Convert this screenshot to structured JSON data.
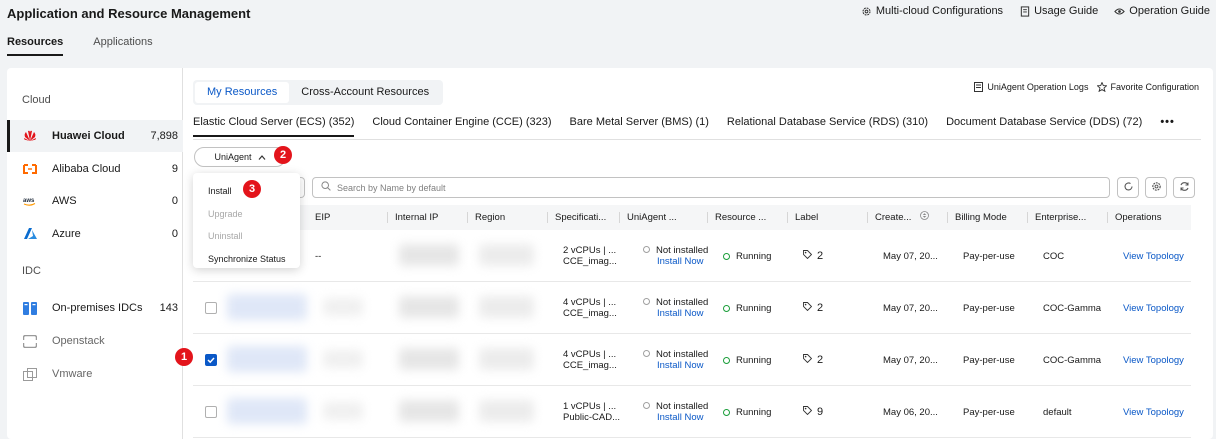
{
  "header": {
    "title": "Application and Resource Management",
    "links": [
      {
        "label": "Multi-cloud Configurations",
        "icon": "gear-icon"
      },
      {
        "label": "Usage Guide",
        "icon": "document-icon"
      },
      {
        "label": "Operation Guide",
        "icon": "eye-icon"
      }
    ],
    "tabs": [
      {
        "label": "Resources",
        "active": true
      },
      {
        "label": "Applications",
        "active": false
      }
    ]
  },
  "sidebar": {
    "groups": [
      {
        "label": "Cloud",
        "items": [
          {
            "label": "Huawei Cloud",
            "count": "7,898",
            "icon": "huawei-logo-icon",
            "active": true
          },
          {
            "label": "Alibaba Cloud",
            "count": "9",
            "icon": "alibaba-logo-icon"
          },
          {
            "label": "AWS",
            "count": "0",
            "icon": "aws-logo-icon"
          },
          {
            "label": "Azure",
            "count": "0",
            "icon": "azure-logo-icon"
          }
        ]
      },
      {
        "label": "IDC",
        "items": [
          {
            "label": "On-premises IDCs",
            "count": "143",
            "icon": "idc-icon"
          },
          {
            "label": "Openstack",
            "count": "",
            "icon": "openstack-icon"
          },
          {
            "label": "Vmware",
            "count": "",
            "icon": "vmware-icon"
          }
        ]
      }
    ]
  },
  "content": {
    "segments": [
      {
        "label": "My Resources",
        "active": true
      },
      {
        "label": "Cross-Account Resources",
        "active": false
      }
    ],
    "right_links": [
      {
        "label": "UniAgent Operation Logs",
        "icon": "log-icon"
      },
      {
        "label": "Favorite Configuration",
        "icon": "star-icon"
      }
    ],
    "service_tabs": [
      {
        "label": "Elastic Cloud Server (ECS) (352)",
        "active": true
      },
      {
        "label": "Cloud Container Engine (CCE) (323)"
      },
      {
        "label": "Bare Metal Server (BMS) (1)"
      },
      {
        "label": "Relational Database Service (RDS) (310)"
      },
      {
        "label": "Document Database Service (DDS) (72)"
      }
    ],
    "more_label": "•••",
    "uniagent_button": "UniAgent",
    "search_placeholder": "Search by Name by default",
    "dropdown": {
      "items": [
        {
          "label": "Install",
          "enabled": true
        },
        {
          "label": "Upgrade",
          "enabled": false
        },
        {
          "label": "Uninstall",
          "enabled": false
        },
        {
          "label": "Synchronize Status",
          "enabled": true
        }
      ]
    },
    "badges": [
      "1",
      "2",
      "3"
    ],
    "table": {
      "columns": [
        "EIP",
        "Internal IP",
        "Region",
        "Specificati...",
        "UniAgent ...",
        "Resource ...",
        "Label",
        "Create...",
        "Billing Mode",
        "Enterprise...",
        "Operations"
      ],
      "rows": [
        {
          "eip": "--",
          "spec1": "2 vCPUs | ...",
          "spec2": "CCE_imag...",
          "ua_status": "Not installed",
          "ua_action": "Install Now",
          "resource": "Running",
          "label": "2",
          "created": "May 07, 20...",
          "billing": "Pay-per-use",
          "enterprise": "COC",
          "operation": "View Topology",
          "checked": false
        },
        {
          "eip": "",
          "spec1": "4 vCPUs | ...",
          "spec2": "CCE_imag...",
          "ua_status": "Not installed",
          "ua_action": "Install Now",
          "resource": "Running",
          "label": "2",
          "created": "May 07, 20...",
          "billing": "Pay-per-use",
          "enterprise": "COC-Gamma",
          "operation": "View Topology",
          "checked": false
        },
        {
          "eip": "",
          "spec1": "4 vCPUs | ...",
          "spec2": "CCE_imag...",
          "ua_status": "Not installed",
          "ua_action": "Install Now",
          "resource": "Running",
          "label": "2",
          "created": "May 07, 20...",
          "billing": "Pay-per-use",
          "enterprise": "COC-Gamma",
          "operation": "View Topology",
          "checked": true
        },
        {
          "eip": "",
          "spec1": "1 vCPUs | ...",
          "spec2": "Public-CAD...",
          "ua_status": "Not installed",
          "ua_action": "Install Now",
          "resource": "Running",
          "label": "9",
          "created": "May 06, 20...",
          "billing": "Pay-per-use",
          "enterprise": "default",
          "operation": "View Topology",
          "checked": false
        }
      ]
    }
  }
}
